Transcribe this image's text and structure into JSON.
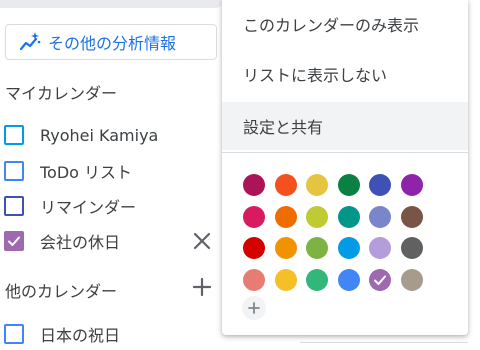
{
  "analytics": {
    "label": "その他の分析情報",
    "icon": "sparkle-chart-icon",
    "color": "#1a73e8"
  },
  "my_calendars": {
    "title": "マイカレンダー",
    "items": [
      {
        "label": "Ryohei Kamiya",
        "color": "#039be5",
        "checked": false
      },
      {
        "label": "ToDo リスト",
        "color": "#4285f4",
        "checked": false
      },
      {
        "label": "リマインダー",
        "color": "#3f51b5",
        "checked": false
      },
      {
        "label": "会社の休日",
        "color": "#9e69af",
        "checked": true
      }
    ]
  },
  "other_calendars": {
    "title": "他のカレンダー",
    "items": [
      {
        "label": "日本の祝日",
        "color": "#4285f4",
        "checked": false
      }
    ]
  },
  "menu": {
    "items": [
      {
        "label": "このカレンダーのみ表示"
      },
      {
        "label": "リストに表示しない"
      },
      {
        "label": "設定と共有"
      }
    ],
    "colors": [
      [
        "#ad1457",
        "#f4511e",
        "#e4c441",
        "#0b8043",
        "#3f51b5",
        "#8e24aa"
      ],
      [
        "#d81b60",
        "#ef6c00",
        "#c0ca33",
        "#009688",
        "#7986cb",
        "#795548"
      ],
      [
        "#d50000",
        "#f09300",
        "#7cb342",
        "#039be5",
        "#b39ddb",
        "#616161"
      ],
      [
        "#e67c73",
        "#f6bf26",
        "#33b679",
        "#4285f4",
        "#9e69af",
        "#a79b8e"
      ]
    ],
    "selected_color": "#9e69af",
    "custom_color_icon": "plus-icon"
  },
  "icons": {
    "close": "close-icon",
    "add": "plus-icon",
    "check": "check-icon"
  }
}
